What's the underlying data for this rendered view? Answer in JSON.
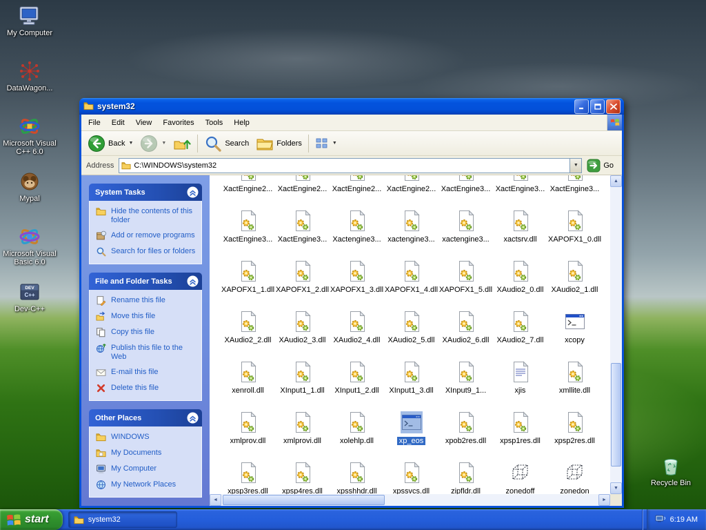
{
  "colors": {
    "titlebar_blue": "#0353dd",
    "window_border": "#0a52d8",
    "selection_blue": "#316ac5",
    "taskbar_blue": "#245edb",
    "start_green": "#2f8f2c",
    "sidebar_panel_body": "#d6dff7",
    "task_link_blue": "#215dc6"
  },
  "desktop": {
    "icons": [
      {
        "label": "My Computer",
        "icon": "my-computer"
      },
      {
        "label": "DataWagon...",
        "icon": "datawagon"
      },
      {
        "label": "Microsoft Visual C++ 6.0",
        "icon": "visual-cpp"
      },
      {
        "label": "Mypal",
        "icon": "mypal"
      },
      {
        "label": "Microsoft Visual Basic 6.0",
        "icon": "visual-basic"
      },
      {
        "label": "Dev-C++",
        "icon": "dev-cpp"
      }
    ],
    "recycle_bin_label": "Recycle Bin"
  },
  "explorer": {
    "title": "system32",
    "menu_items": [
      "File",
      "Edit",
      "View",
      "Favorites",
      "Tools",
      "Help"
    ],
    "toolbar": {
      "back_label": "Back",
      "search_label": "Search",
      "folders_label": "Folders"
    },
    "address_bar": {
      "label": "Address",
      "path": "C:\\WINDOWS\\system32",
      "go_label": "Go"
    },
    "sidebar": {
      "panels": [
        {
          "title": "System Tasks",
          "items": [
            {
              "label": "Hide the contents of this folder",
              "icon": "folder"
            },
            {
              "label": "Add or remove programs",
              "icon": "programs"
            },
            {
              "label": "Search for files or folders",
              "icon": "search"
            }
          ]
        },
        {
          "title": "File and Folder Tasks",
          "items": [
            {
              "label": "Rename this file",
              "icon": "rename"
            },
            {
              "label": "Move this file",
              "icon": "move"
            },
            {
              "label": "Copy this file",
              "icon": "copy"
            },
            {
              "label": "Publish this file to the Web",
              "icon": "publish"
            },
            {
              "label": "E-mail this file",
              "icon": "email"
            },
            {
              "label": "Delete this file",
              "icon": "delete"
            }
          ]
        },
        {
          "title": "Other Places",
          "items": [
            {
              "label": "WINDOWS",
              "icon": "folder"
            },
            {
              "label": "My Documents",
              "icon": "documents"
            },
            {
              "label": "My Computer",
              "icon": "computer"
            },
            {
              "label": "My Network Places",
              "icon": "network"
            }
          ]
        }
      ]
    },
    "files": [
      {
        "name": "XactEngine2...",
        "icon": "dll"
      },
      {
        "name": "XactEngine2...",
        "icon": "dll"
      },
      {
        "name": "XactEngine2...",
        "icon": "dll"
      },
      {
        "name": "XactEngine2...",
        "icon": "dll"
      },
      {
        "name": "XactEngine3...",
        "icon": "dll"
      },
      {
        "name": "XactEngine3...",
        "icon": "dll"
      },
      {
        "name": "XactEngine3...",
        "icon": "dll"
      },
      {
        "name": "XactEngine3...",
        "icon": "dll"
      },
      {
        "name": "XactEngine3...",
        "icon": "dll"
      },
      {
        "name": "Xactengine3...",
        "icon": "dll"
      },
      {
        "name": "xactengine3...",
        "icon": "dll"
      },
      {
        "name": "xactengine3...",
        "icon": "dll"
      },
      {
        "name": "xactsrv.dll",
        "icon": "dll"
      },
      {
        "name": "XAPOFX1_0.dll",
        "icon": "dll"
      },
      {
        "name": "XAPOFX1_1.dll",
        "icon": "dll"
      },
      {
        "name": "XAPOFX1_2.dll",
        "icon": "dll"
      },
      {
        "name": "XAPOFX1_3.dll",
        "icon": "dll"
      },
      {
        "name": "XAPOFX1_4.dll",
        "icon": "dll"
      },
      {
        "name": "XAPOFX1_5.dll",
        "icon": "dll"
      },
      {
        "name": "XAudio2_0.dll",
        "icon": "dll"
      },
      {
        "name": "XAudio2_1.dll",
        "icon": "dll"
      },
      {
        "name": "XAudio2_2.dll",
        "icon": "dll"
      },
      {
        "name": "XAudio2_3.dll",
        "icon": "dll"
      },
      {
        "name": "XAudio2_4.dll",
        "icon": "dll"
      },
      {
        "name": "XAudio2_5.dll",
        "icon": "dll"
      },
      {
        "name": "XAudio2_6.dll",
        "icon": "dll"
      },
      {
        "name": "XAudio2_7.dll",
        "icon": "dll"
      },
      {
        "name": "xcopy",
        "icon": "app"
      },
      {
        "name": "xenroll.dll",
        "icon": "dll"
      },
      {
        "name": "XInput1_1.dll",
        "icon": "dll"
      },
      {
        "name": "XInput1_2.dll",
        "icon": "dll"
      },
      {
        "name": "XInput1_3.dll",
        "icon": "dll"
      },
      {
        "name": "XInput9_1...",
        "icon": "dll"
      },
      {
        "name": "xjis",
        "icon": "textfile"
      },
      {
        "name": "xmllite.dll",
        "icon": "dll"
      },
      {
        "name": "xmlprov.dll",
        "icon": "dll"
      },
      {
        "name": "xmlprovi.dll",
        "icon": "dll"
      },
      {
        "name": "xolehlp.dll",
        "icon": "dll"
      },
      {
        "name": "xp_eos",
        "icon": "app",
        "selected": true
      },
      {
        "name": "xpob2res.dll",
        "icon": "dll"
      },
      {
        "name": "xpsp1res.dll",
        "icon": "dll"
      },
      {
        "name": "xpsp2res.dll",
        "icon": "dll"
      },
      {
        "name": "xpsp3res.dll",
        "icon": "dll"
      },
      {
        "name": "xpsp4res.dll",
        "icon": "dll"
      },
      {
        "name": "xpsshhdr.dll",
        "icon": "dll"
      },
      {
        "name": "xpssvcs.dll",
        "icon": "dll"
      },
      {
        "name": "zipfldr.dll",
        "icon": "dll"
      },
      {
        "name": "zonedoff",
        "icon": "cube"
      },
      {
        "name": "zonedon",
        "icon": "cube"
      }
    ]
  },
  "taskbar": {
    "start_label": "start",
    "tasks": [
      {
        "label": "system32",
        "icon": "folder"
      }
    ],
    "tray": {
      "time": "6:19 AM"
    }
  }
}
